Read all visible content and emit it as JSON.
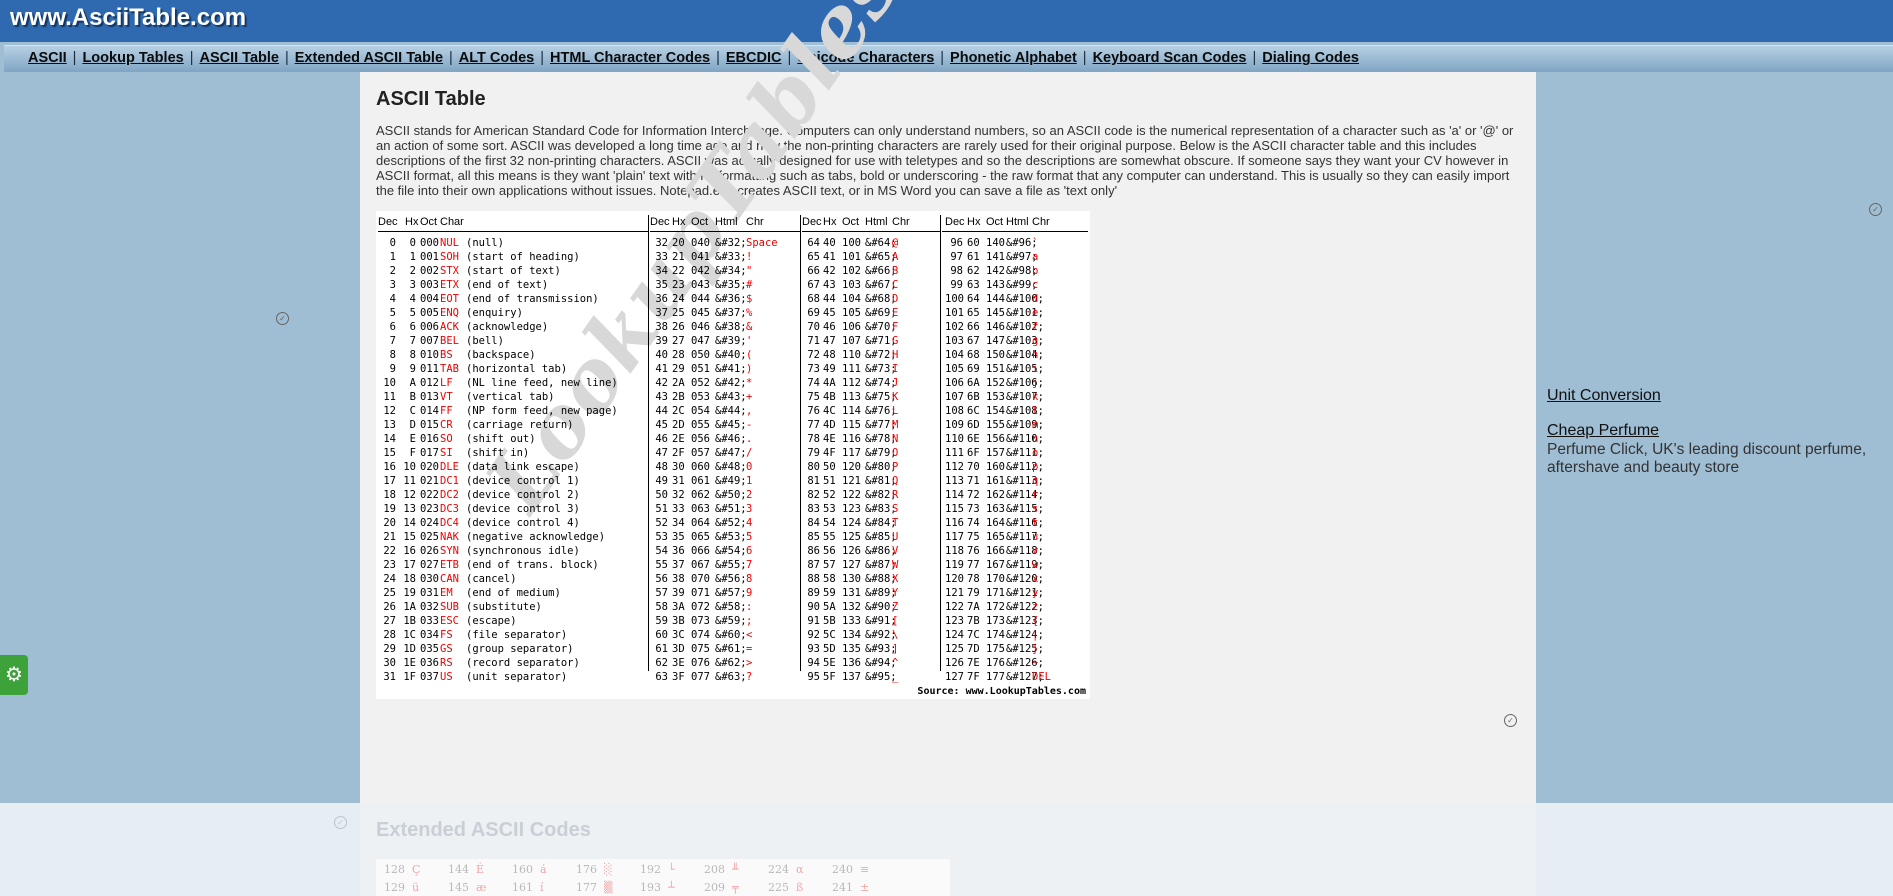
{
  "site": {
    "logo": "www.AsciiTable.com"
  },
  "nav": [
    "ASCII",
    "Lookup Tables",
    "ASCII Table",
    "Extended ASCII Table",
    "ALT Codes",
    "HTML Character Codes",
    "EBCDIC",
    "Unicode Characters",
    "Phonetic Alphabet",
    "Keyboard Scan Codes",
    "Dialing Codes"
  ],
  "main": {
    "title": "ASCII Table",
    "intro": "ASCII stands for American Standard Code for Information Interchange. Computers can only understand numbers, so an ASCII code is the numerical representation of a character such as 'a' or '@' or an action of some sort. ASCII was developed a long time ago and now the non-printing characters are rarely used for their original purpose. Below is the ASCII character table and this includes descriptions of the first 32 non-printing characters. ASCII was actually designed for use with teletypes and so the descriptions are somewhat obscure. If someone says they want your CV however in ASCII format, all this means is they want 'plain' text with no formatting such as tabs, bold or underscoring - the raw format that any computer can understand. This is usually so they can easily import the file into their own applications without issues. Notepad.exe creates ASCII text, or in MS Word you can save a file as 'text only'"
  },
  "ascii_table": {
    "headers": {
      "b1": [
        "Dec",
        "Hx",
        "Oct",
        "Char"
      ],
      "b2": [
        "Dec",
        "Hx",
        "Oct",
        "Html",
        "Chr"
      ],
      "b3": [
        "Dec",
        "Hx",
        "Oct",
        "Html",
        "Chr"
      ],
      "b4": [
        "Dec",
        "Hx",
        "Oct",
        "Html",
        "Chr"
      ]
    },
    "control": [
      [
        "0",
        "0",
        "000",
        "NUL",
        "(null)"
      ],
      [
        "1",
        "1",
        "001",
        "SOH",
        "(start of heading)"
      ],
      [
        "2",
        "2",
        "002",
        "STX",
        "(start of text)"
      ],
      [
        "3",
        "3",
        "003",
        "ETX",
        "(end of text)"
      ],
      [
        "4",
        "4",
        "004",
        "EOT",
        "(end of transmission)"
      ],
      [
        "5",
        "5",
        "005",
        "ENQ",
        "(enquiry)"
      ],
      [
        "6",
        "6",
        "006",
        "ACK",
        "(acknowledge)"
      ],
      [
        "7",
        "7",
        "007",
        "BEL",
        "(bell)"
      ],
      [
        "8",
        "8",
        "010",
        "BS",
        "(backspace)"
      ],
      [
        "9",
        "9",
        "011",
        "TAB",
        "(horizontal tab)"
      ],
      [
        "10",
        "A",
        "012",
        "LF",
        "(NL line feed, new line)"
      ],
      [
        "11",
        "B",
        "013",
        "VT",
        "(vertical tab)"
      ],
      [
        "12",
        "C",
        "014",
        "FF",
        "(NP form feed, new page)"
      ],
      [
        "13",
        "D",
        "015",
        "CR",
        "(carriage return)"
      ],
      [
        "14",
        "E",
        "016",
        "SO",
        "(shift out)"
      ],
      [
        "15",
        "F",
        "017",
        "SI",
        "(shift in)"
      ],
      [
        "16",
        "10",
        "020",
        "DLE",
        "(data link escape)"
      ],
      [
        "17",
        "11",
        "021",
        "DC1",
        "(device control 1)"
      ],
      [
        "18",
        "12",
        "022",
        "DC2",
        "(device control 2)"
      ],
      [
        "19",
        "13",
        "023",
        "DC3",
        "(device control 3)"
      ],
      [
        "20",
        "14",
        "024",
        "DC4",
        "(device control 4)"
      ],
      [
        "21",
        "15",
        "025",
        "NAK",
        "(negative acknowledge)"
      ],
      [
        "22",
        "16",
        "026",
        "SYN",
        "(synchronous idle)"
      ],
      [
        "23",
        "17",
        "027",
        "ETB",
        "(end of trans. block)"
      ],
      [
        "24",
        "18",
        "030",
        "CAN",
        "(cancel)"
      ],
      [
        "25",
        "19",
        "031",
        "EM",
        "(end of medium)"
      ],
      [
        "26",
        "1A",
        "032",
        "SUB",
        "(substitute)"
      ],
      [
        "27",
        "1B",
        "033",
        "ESC",
        "(escape)"
      ],
      [
        "28",
        "1C",
        "034",
        "FS",
        "(file separator)"
      ],
      [
        "29",
        "1D",
        "035",
        "GS",
        "(group separator)"
      ],
      [
        "30",
        "1E",
        "036",
        "RS",
        "(record separator)"
      ],
      [
        "31",
        "1F",
        "037",
        "US",
        "(unit separator)"
      ]
    ],
    "chr2": [
      "Space",
      "!",
      "\"",
      "#",
      "$",
      "%",
      "&",
      "'",
      "(",
      ")",
      "*",
      "+",
      ",",
      "-",
      ".",
      "/",
      "0",
      "1",
      "2",
      "3",
      "4",
      "5",
      "6",
      "7",
      "8",
      "9",
      ":",
      ";",
      "<",
      "=",
      ">",
      "?"
    ],
    "chr3": [
      "@",
      "A",
      "B",
      "C",
      "D",
      "E",
      "F",
      "G",
      "H",
      "I",
      "J",
      "K",
      "L",
      "M",
      "N",
      "O",
      "P",
      "Q",
      "R",
      "S",
      "T",
      "U",
      "V",
      "W",
      "X",
      "Y",
      "Z",
      "[",
      "\\",
      "]",
      "^",
      "_"
    ],
    "chr4": [
      "`",
      "a",
      "b",
      "c",
      "d",
      "e",
      "f",
      "g",
      "h",
      "i",
      "j",
      "k",
      "l",
      "m",
      "n",
      "o",
      "p",
      "q",
      "r",
      "s",
      "t",
      "u",
      "v",
      "w",
      "x",
      "y",
      "z",
      "{",
      "|",
      "}",
      "~",
      "DEL"
    ],
    "watermark": "LookupTables",
    "source": "Source: www.LookupTables.com"
  },
  "sidebar": {
    "ad1": "Unit Conversion",
    "ad2_title": "Cheap Perfume",
    "ad2_desc": "Perfume Click, UK's leading discount perfume, aftershave and beauty store"
  },
  "extended": {
    "title": "Extended ASCII Codes",
    "row1": [
      [
        "128",
        "Ç"
      ],
      [
        "144",
        "É"
      ],
      [
        "160",
        "á"
      ],
      [
        "176",
        "░"
      ],
      [
        "192",
        "└"
      ],
      [
        "208",
        "╨"
      ],
      [
        "224",
        "α"
      ],
      [
        "240",
        "≡"
      ]
    ],
    "row2": [
      [
        "129",
        "ü"
      ],
      [
        "145",
        "æ"
      ],
      [
        "161",
        "í"
      ],
      [
        "177",
        "▒"
      ],
      [
        "193",
        "┴"
      ],
      [
        "209",
        "╤"
      ],
      [
        "225",
        "ß"
      ],
      [
        "241",
        "±"
      ]
    ]
  }
}
